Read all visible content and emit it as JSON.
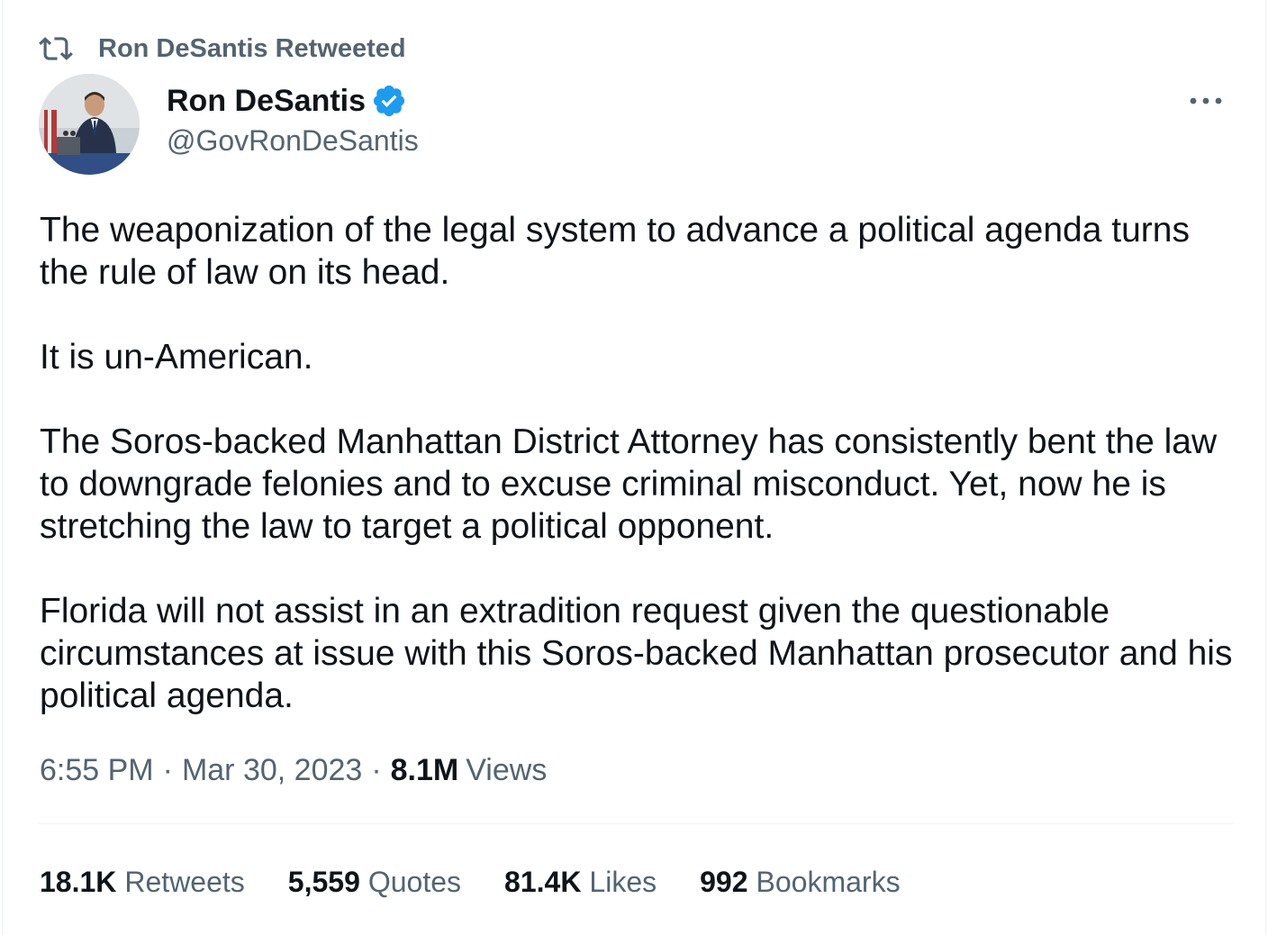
{
  "social_context": {
    "text": "Ron DeSantis Retweeted",
    "icon": "retweet-icon"
  },
  "author": {
    "display_name": "Ron DeSantis",
    "handle": "@GovRonDeSantis",
    "verified": true,
    "verified_color": "#1d9bf0"
  },
  "tweet": {
    "paragraphs": [
      "The weaponization of the legal system to advance a political agenda turns the rule of law on its head.",
      "It is un-American.",
      "The Soros-backed Manhattan District Attorney has consistently bent the law to downgrade felonies and to excuse criminal misconduct. Yet, now he is stretching the law to target a political opponent.",
      "Florida will not assist in an extradition request given the questionable circumstances at issue with this Soros-backed Manhattan prosecutor and his political agenda."
    ],
    "time": "6:55 PM",
    "date": "Mar 30, 2023",
    "views_count": "8.1M",
    "views_label": "Views"
  },
  "stats": {
    "retweets": {
      "count": "18.1K",
      "label": "Retweets"
    },
    "quotes": {
      "count": "5,559",
      "label": "Quotes"
    },
    "likes": {
      "count": "81.4K",
      "label": "Likes"
    },
    "bookmarks": {
      "count": "992",
      "label": "Bookmarks"
    }
  },
  "colors": {
    "text": "#0f1419",
    "secondary": "#536471",
    "divider": "#eff3f4"
  }
}
